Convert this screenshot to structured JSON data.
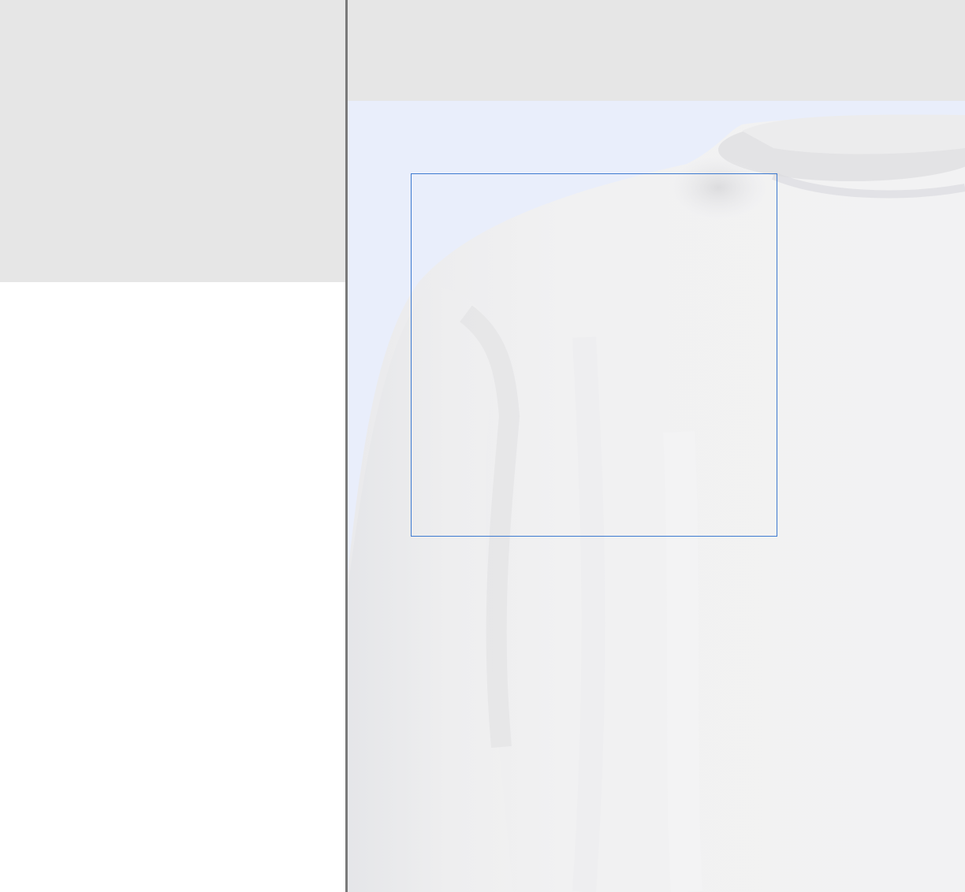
{
  "app": {
    "left_pane": {},
    "right_pane": {
      "image": {
        "description_icon": "product-photo-white-sweatshirt"
      },
      "zoom_lens": {}
    }
  },
  "colors": {
    "panel_gray": "#e6e6e6",
    "divider": "#7a7a7a",
    "image_background": "#e9eefb",
    "lens_border": "#3d7ad0"
  }
}
